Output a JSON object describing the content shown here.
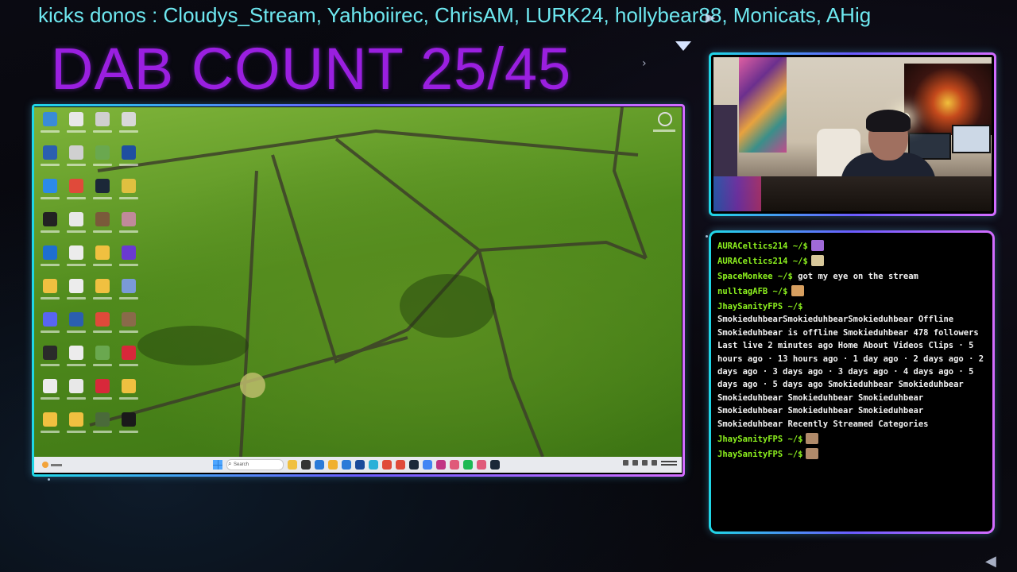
{
  "ticker": {
    "text": "kicks donos : Cloudys_Stream, Yahboiirec, ChrisAM, LURK24, hollybear88, Monicats, AHig"
  },
  "counter": {
    "text": "DAB COUNT 25/45"
  },
  "desktop": {
    "icons": [
      {
        "color": "#3a8bd8"
      },
      {
        "color": "#e8e8e8"
      },
      {
        "color": "#cfcfcf"
      },
      {
        "color": "#d8d8d8"
      },
      {
        "color": "#2b5fb0"
      },
      {
        "color": "#d0d0d0"
      },
      {
        "color": "#6aa84f"
      },
      {
        "color": "#1f4fa0"
      },
      {
        "color": "#2c8ae8"
      },
      {
        "color": "#e04a3a"
      },
      {
        "color": "#1b2838"
      },
      {
        "color": "#e0c040"
      },
      {
        "color": "#222222"
      },
      {
        "color": "#e8e8e8"
      },
      {
        "color": "#7a5a3a"
      },
      {
        "color": "#c08a9a"
      },
      {
        "color": "#1e6fd0"
      },
      {
        "color": "#ececec"
      },
      {
        "color": "#f0c040"
      },
      {
        "color": "#6a3ad0"
      },
      {
        "color": "#f0c040"
      },
      {
        "color": "#ececec"
      },
      {
        "color": "#f0c040"
      },
      {
        "color": "#7a9ad8"
      },
      {
        "color": "#5865f2"
      },
      {
        "color": "#2b5fb0"
      },
      {
        "color": "#e04a3a"
      },
      {
        "color": "#8a6a4a"
      },
      {
        "color": "#2a2a2a"
      },
      {
        "color": "#ececec"
      },
      {
        "color": "#6aa84f"
      },
      {
        "color": "#d8283a"
      },
      {
        "color": "#ececec"
      },
      {
        "color": "#e8e8e8"
      },
      {
        "color": "#d8283a"
      },
      {
        "color": "#f0c040"
      },
      {
        "color": "#f0c040"
      },
      {
        "color": "#f0c040"
      },
      {
        "color": "#4a6a3a"
      },
      {
        "color": "#1a1a1a"
      }
    ]
  },
  "taskbar": {
    "search_placeholder": "Search",
    "apps": [
      {
        "color": "#f0c040"
      },
      {
        "color": "#333333"
      },
      {
        "color": "#2a7ad8"
      },
      {
        "color": "#f0b030"
      },
      {
        "color": "#2a7ad8"
      },
      {
        "color": "#1a4a9a"
      },
      {
        "color": "#2ab0d8"
      },
      {
        "color": "#e04a3a"
      },
      {
        "color": "#e04a3a"
      },
      {
        "color": "#1b2838"
      },
      {
        "color": "#4285f4"
      },
      {
        "color": "#c13584"
      },
      {
        "color": "#e05a7a"
      },
      {
        "color": "#1db954"
      },
      {
        "color": "#e05a7a"
      },
      {
        "color": "#1b2838"
      }
    ]
  },
  "chat": {
    "messages": [
      {
        "user": "AURACeltics214 ~/$",
        "text": "",
        "badge_color": "#a06ad8"
      },
      {
        "user": "AURACeltics214 ~/$",
        "text": "",
        "badge_color": "#d8c89a"
      },
      {
        "user": "SpaceMonkee ~/$",
        "text": "got my eye on the stream",
        "badge_color": ""
      },
      {
        "user": "nulltagAFB ~/$",
        "text": "",
        "badge_color": "#d8a060"
      },
      {
        "user": "JhaySanityFPS ~/$",
        "text": "SmokieduhbearSmokieduhbearSmokieduhbear Offline Smokieduhbear is offline Smokieduhbear 478 followers Last live 2 minutes ago Home About Videos Clips · 5 hours ago · 13 hours ago · 1 day ago · 2 days ago · 2 days ago · 3 days ago · 3 days ago · 4 days ago · 5 days ago · 5 days ago Smokieduhbear Smokieduhbear Smokieduhbear Smokieduhbear Smokieduhbear Smokieduhbear Smokieduhbear Smokieduhbear Smokieduhbear Recently Streamed Categories",
        "badge_color": ""
      },
      {
        "user": "JhaySanityFPS ~/$",
        "text": "",
        "badge_color": "#b08a6a"
      },
      {
        "user": "JhaySanityFPS ~/$",
        "text": "",
        "badge_color": "#b08a6a"
      }
    ]
  },
  "colors": {
    "ticker": "#6ee8f0",
    "counter": "#9a1fe0",
    "chat_user": "#8cf01e",
    "frame_start": "#1fd7e6",
    "frame_end": "#d36cff"
  }
}
